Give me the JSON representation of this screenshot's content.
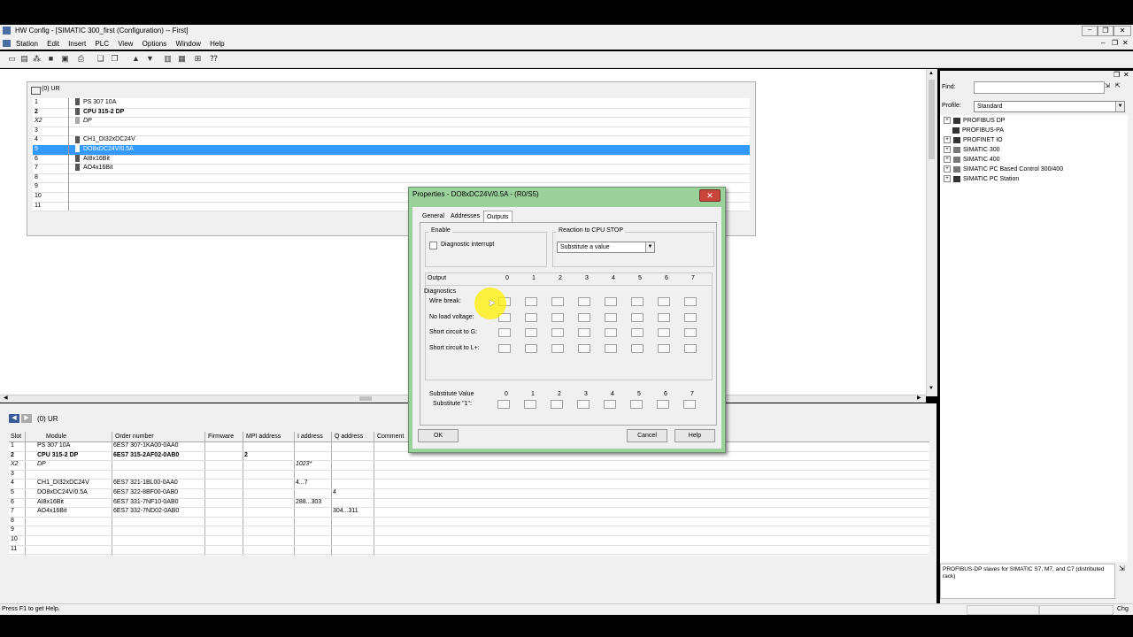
{
  "window": {
    "title": "HW Config - [SIMATIC 300_first (Configuration) -- First]"
  },
  "menu": [
    "Station",
    "Edit",
    "Insert",
    "PLC",
    "View",
    "Options",
    "Window",
    "Help"
  ],
  "rack": {
    "title": "(0) UR",
    "rows": [
      {
        "slot": "1",
        "module": "PS 307 10A"
      },
      {
        "slot": "2",
        "module": "CPU 315-2 DP"
      },
      {
        "slot": "X2",
        "module": "DP"
      },
      {
        "slot": "3",
        "module": ""
      },
      {
        "slot": "4",
        "module": "CH1_DI32xDC24V"
      },
      {
        "slot": "5",
        "module": "DO8xDC24V/0.5A"
      },
      {
        "slot": "6",
        "module": "AI8x16Bit"
      },
      {
        "slot": "7",
        "module": "AO4x16Bit"
      },
      {
        "slot": "8",
        "module": ""
      },
      {
        "slot": "9",
        "module": ""
      },
      {
        "slot": "10",
        "module": ""
      },
      {
        "slot": "11",
        "module": ""
      }
    ]
  },
  "detail": {
    "nav_label": "(0)  UR",
    "headers": [
      "Slot",
      "Module",
      "Order number",
      "Firmware",
      "MPI address",
      "I address",
      "Q address",
      "Comment"
    ],
    "rows": [
      {
        "slot": "1",
        "module": "PS 307 10A",
        "order": "6ES7 307-1KA00-0AA0",
        "fw": "",
        "mpi": "",
        "i": "",
        "q": ""
      },
      {
        "slot": "2",
        "module": "CPU 315-2 DP",
        "order": "6ES7 315-2AF02-0AB0",
        "fw": "",
        "mpi": "2",
        "i": "",
        "q": ""
      },
      {
        "slot": "X2",
        "module": "DP",
        "order": "",
        "fw": "",
        "mpi": "",
        "i": "1023*",
        "q": ""
      },
      {
        "slot": "3",
        "module": "",
        "order": "",
        "fw": "",
        "mpi": "",
        "i": "",
        "q": ""
      },
      {
        "slot": "4",
        "module": "CH1_DI32xDC24V",
        "order": "6ES7 321-1BL00-0AA0",
        "fw": "",
        "mpi": "",
        "i": "4...7",
        "q": ""
      },
      {
        "slot": "5",
        "module": "DO8xDC24V/0.5A",
        "order": "6ES7 322-8BF00-0AB0",
        "fw": "",
        "mpi": "",
        "i": "",
        "q": "4"
      },
      {
        "slot": "6",
        "module": "AI8x16Bit",
        "order": "6ES7 331-7NF10-0AB0",
        "fw": "",
        "mpi": "",
        "i": "288...303",
        "q": ""
      },
      {
        "slot": "7",
        "module": "AO4x16Bit",
        "order": "6ES7 332-7ND02-0AB0",
        "fw": "",
        "mpi": "",
        "i": "",
        "q": "304...311"
      },
      {
        "slot": "8",
        "module": "",
        "order": "",
        "fw": "",
        "mpi": "",
        "i": "",
        "q": ""
      },
      {
        "slot": "9",
        "module": "",
        "order": "",
        "fw": "",
        "mpi": "",
        "i": "",
        "q": ""
      },
      {
        "slot": "10",
        "module": "",
        "order": "",
        "fw": "",
        "mpi": "",
        "i": "",
        "q": ""
      },
      {
        "slot": "11",
        "module": "",
        "order": "",
        "fw": "",
        "mpi": "",
        "i": "",
        "q": ""
      }
    ]
  },
  "catalog": {
    "find_label": "Find:",
    "find_value": "",
    "profile_label": "Profile:",
    "profile_value": "Standard",
    "tree": [
      "PROFIBUS DP",
      "PROFIBUS-PA",
      "PROFINET IO",
      "SIMATIC 300",
      "SIMATIC 400",
      "SIMATIC PC Based Control 300/400",
      "SIMATIC PC Station"
    ],
    "info": "PROFIBUS-DP slaves for SIMATIC S7, M7, and C7 (distributed rack)"
  },
  "status": {
    "text": "Press F1 to get Help.",
    "right": "Chg"
  },
  "dialog": {
    "title": "Properties - DO8xDC24V/0.5A - (R0/S5)",
    "close": "✕",
    "tabs": [
      "General",
      "Addresses",
      "Outputs"
    ],
    "active_tab": "Outputs",
    "enable_group": "Enable",
    "diag_interrupt": "Diagnostic interrupt",
    "reaction_group": "Reaction to CPU STOP",
    "reaction_value": "Substitute a value",
    "output_label": "Output",
    "channels": [
      "0",
      "1",
      "2",
      "3",
      "4",
      "5",
      "6",
      "7"
    ],
    "diagnostics_label": "Diagnostics",
    "diag_rows": [
      "Wire break:",
      "No load voltage:",
      "Short circuit to G:",
      "Short circuit to L+:"
    ],
    "substitute_value_label": "Substitute Value",
    "substitute_1_label": "Substitute \"1\":",
    "ok": "OK",
    "cancel": "Cancel",
    "help": "Help"
  }
}
